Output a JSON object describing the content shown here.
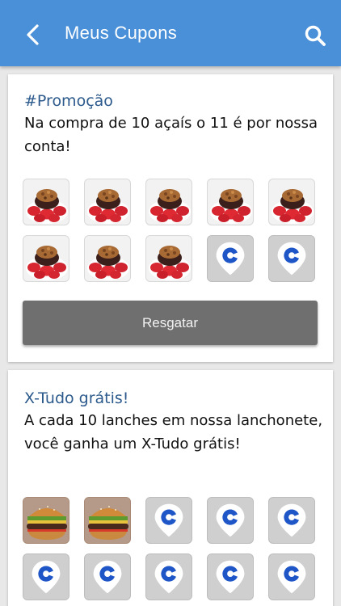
{
  "header": {
    "title": "Meus Cupons",
    "back_icon": "back-chevron-icon",
    "search_icon": "search-icon",
    "bar_color": "#4a90d9"
  },
  "cards": [
    {
      "title": "#Promoção",
      "description": "Na compra de 10 açaís o 11 é por nossa conta!",
      "stamps_collected": 8,
      "stamps_total": 10,
      "stamp_image": "acai-bowl-image",
      "empty_icon": "brand-location-pin-icon",
      "button_label": "Resgatar"
    },
    {
      "title": "X-Tudo grátis!",
      "description": "A cada 10 lanches em nossa lanchonete, você ganha um X-Tudo grátis!",
      "stamps_collected": 2,
      "stamps_total": 10,
      "stamp_image": "burger-image",
      "empty_icon": "brand-location-pin-icon"
    }
  ]
}
